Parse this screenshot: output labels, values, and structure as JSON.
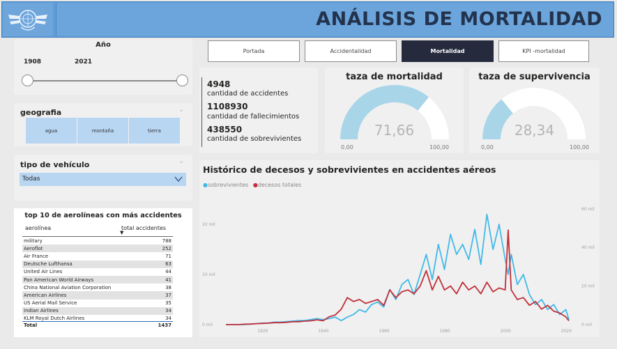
{
  "header": {
    "title": "ANÁLISIS DE MORTALIDAD"
  },
  "year_slicer": {
    "title": "Año",
    "start": "1908",
    "end": "2021"
  },
  "geografia": {
    "title": "geografia",
    "options": [
      "agua",
      "montaña",
      "tierra"
    ]
  },
  "vehiculo": {
    "title": "tipo de vehículo",
    "selected": "Todas"
  },
  "nav": {
    "buttons": [
      "Portada",
      "Accidentalidad",
      "Mortalidad",
      "KPI -mortalidad"
    ],
    "active": "Mortalidad"
  },
  "kpis": [
    {
      "value": "4948",
      "label": "cantidad de accidentes"
    },
    {
      "value": "1108930",
      "label": "cantidad de fallecimientos"
    },
    {
      "value": "438550",
      "label": "cantidad de sobrevivientes"
    }
  ],
  "gauge_mortalidad": {
    "title": "taza de mortalidad",
    "value": "71,66",
    "value_num": 71.66,
    "min": "0,00",
    "max": "100,00"
  },
  "gauge_supervivencia": {
    "title": "taza de supervivencia",
    "value": "28,34",
    "value_num": 28.34,
    "min": "0,00",
    "max": "100,00"
  },
  "top10": {
    "title": "top 10 de aerolíneas con más accidentes",
    "col1": "aerolínea",
    "col2": "total accidentes",
    "rows": [
      [
        "military",
        "788"
      ],
      [
        "Aeroflot",
        "252"
      ],
      [
        "Air France",
        "71"
      ],
      [
        "Deutsche Lufthansa",
        "63"
      ],
      [
        "United Air Lines",
        "44"
      ],
      [
        "Pan American World Airways",
        "41"
      ],
      [
        "China National Aviation Corporation",
        "38"
      ],
      [
        "American Airlines",
        "37"
      ],
      [
        "US Aerial Mail Service",
        "35"
      ],
      [
        "Indian Airlines",
        "34"
      ],
      [
        "KLM Royal Dutch Airlines",
        "34"
      ]
    ],
    "total_label": "Total",
    "total_value": "1437"
  },
  "colors": {
    "sobrevivientes": "#41b9e8",
    "decesos": "#c0303a",
    "gauge_fill": "#a9d5e9",
    "gauge_bg": "#ffffff",
    "title_bar": "#6ba5db",
    "active_btn": "#252a3d"
  },
  "chart_data": {
    "type": "line",
    "title": "Histórico de decesos y sobrevivientes en accidentes aéreos",
    "x": [
      1908,
      1910,
      1912,
      1914,
      1916,
      1918,
      1920,
      1922,
      1924,
      1926,
      1928,
      1930,
      1932,
      1934,
      1936,
      1938,
      1940,
      1942,
      1944,
      1946,
      1948,
      1950,
      1952,
      1954,
      1956,
      1958,
      1960,
      1962,
      1964,
      1966,
      1968,
      1970,
      1972,
      1974,
      1976,
      1978,
      1980,
      1982,
      1984,
      1986,
      1988,
      1990,
      1992,
      1994,
      1996,
      1998,
      2000,
      2001,
      2002,
      2004,
      2006,
      2008,
      2010,
      2012,
      2014,
      2016,
      2018,
      2020,
      2021
    ],
    "series": [
      {
        "name": "sobrevivientes",
        "axis": "left",
        "values": [
          0,
          0,
          0,
          0,
          0.1,
          0.2,
          0.3,
          0.3,
          0.5,
          0.5,
          0.6,
          0.7,
          0.8,
          0.8,
          1.0,
          1.2,
          1.0,
          1.2,
          1.5,
          0.8,
          1.5,
          2.0,
          3.0,
          2.5,
          4.0,
          4.5,
          3.5,
          7.0,
          5.0,
          8.0,
          9.0,
          6.0,
          10.0,
          14.0,
          9.0,
          16.0,
          11.0,
          18.0,
          14.0,
          16.0,
          13.0,
          19.0,
          12.0,
          22.0,
          15.0,
          20.0,
          13.0,
          10.0,
          14.0,
          8.0,
          10.0,
          6.0,
          4.0,
          5.0,
          3.0,
          4.0,
          2.0,
          3.0,
          1.0
        ]
      },
      {
        "name": "decesos totales",
        "axis": "right",
        "values": [
          0,
          0,
          0,
          0.2,
          0.3,
          0.5,
          0.6,
          0.8,
          1.0,
          1.0,
          1.2,
          1.5,
          1.5,
          1.8,
          2.0,
          2.5,
          2.0,
          4.0,
          5.0,
          8.0,
          14.0,
          12.0,
          13.0,
          11.0,
          12.0,
          13.0,
          10.0,
          18.0,
          14.0,
          17.0,
          18.0,
          16.0,
          20.0,
          28.0,
          18.0,
          25.0,
          18.0,
          20.0,
          16.0,
          22.0,
          18.0,
          20.0,
          16.0,
          22.0,
          17.0,
          19.0,
          18.0,
          49.0,
          18.0,
          13.0,
          14.0,
          10.0,
          12.0,
          8.0,
          10.0,
          7.0,
          6.0,
          4.0,
          2.0
        ]
      }
    ],
    "left_axis": {
      "ticks": [
        "0 mil",
        "10 mil",
        "20 mil"
      ],
      "range": [
        0,
        25
      ]
    },
    "right_axis": {
      "ticks": [
        "0 mil",
        "20 mil",
        "40 mil",
        "60 mil"
      ],
      "range": [
        0,
        65
      ]
    },
    "x_ticks": [
      "1920",
      "1940",
      "1960",
      "1980",
      "2000",
      "2020"
    ],
    "xlim": [
      1908,
      2021
    ],
    "legend_position": "top-left",
    "grid": false
  }
}
